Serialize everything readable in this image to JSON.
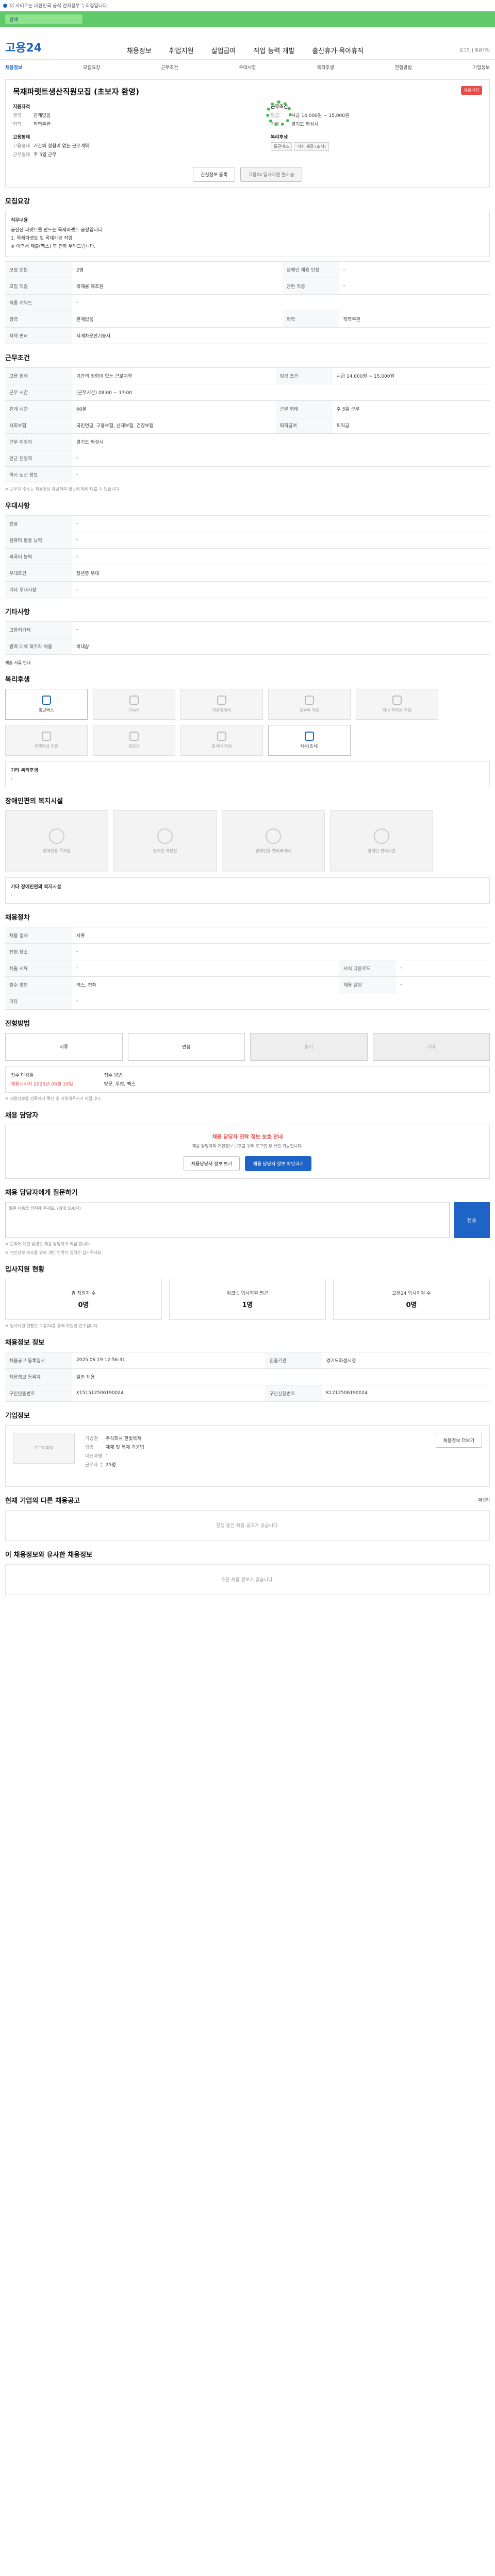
{
  "topbar": {
    "text": "이 사이트는 대한민국 공식 전자정부 누리집입니다."
  },
  "search": {
    "label": "검색"
  },
  "header": {
    "logo_prefix": "고용",
    "logo_suffix": "24",
    "gnb": [
      "채용정보",
      "취업지원",
      "실업급여",
      "직업 능력 개발",
      "출산휴가·육아휴직"
    ],
    "util": "로그인 | 회원가입"
  },
  "tabs": [
    "채용정보",
    "모집요강",
    "근무조건",
    "우대사항",
    "복리후생",
    "전형방법",
    "기업정보"
  ],
  "summary": {
    "title": "목재파렛트생산직원모집 (초보자 환영)",
    "badge": "채용마감",
    "group1": "지원자격",
    "rows1": [
      {
        "k": "경력",
        "v": "관계없음"
      },
      {
        "k": "학력",
        "v": "학력무관"
      }
    ],
    "group2": "고용형태",
    "rows2": [
      {
        "k": "고용형태",
        "v": "기간의 정함이 없는 근로계약"
      },
      {
        "k": "근무형태",
        "v": "주 5일 근무"
      }
    ],
    "group3": "근무조건",
    "rows3": [
      {
        "k": "임금",
        "v": "시급 14,000원 ~ 15,000원"
      },
      {
        "k": "지역",
        "v": "경기도 화성시"
      }
    ],
    "group4": "복리후생",
    "tags": [
      "통근버스",
      "식사 제공 (조식)"
    ],
    "btn_scrap": "관심정보 등록",
    "btn_apply": "고용24 입사지원 불가능"
  },
  "recruit": {
    "title": "모집요강",
    "job_title": "직무내용",
    "job_lines": [
      "공산산 파렛트를 만드는 목재파렛트 공장입니다.",
      "1. 목재파렛트 및 목재가공 작업",
      "※ 이력서 제출(팩스) 후 전화 부탁드립니다."
    ],
    "rows": [
      {
        "k": "모집 인원",
        "v": "2명",
        "k2": "장애인 채용 인정",
        "v2": "-"
      },
      {
        "k": "모집 직종",
        "v": "목재를 제조원",
        "k2": "관련 직종",
        "v2": "-"
      },
      {
        "k": "직종 키워드",
        "v": "-",
        "k2": "",
        "v2": ""
      },
      {
        "k": "경력",
        "v": "관계없음",
        "k2": "학력",
        "v2": "학력무관"
      },
      {
        "k": "자격 면허",
        "v": "지게차운전기능사",
        "k2": "",
        "v2": ""
      }
    ]
  },
  "conditions": {
    "title": "근무조건",
    "rows": [
      {
        "k": "고용 형태",
        "v": "기간의 정함이 없는 근로계약",
        "k2": "임금 조건",
        "v2": "시급 14,000원 ~ 15,000원"
      },
      {
        "k": "근무 시간",
        "v": "(근무시간) 08:00 ~ 17:00",
        "k2": "",
        "v2": ""
      },
      {
        "k": "휴게 시간",
        "v": "60분",
        "k2": "근무 형태",
        "v2": "주 5일 근무"
      },
      {
        "k": "사회보험",
        "v": "국민연금, 고용보험, 산재보험, 건강보험",
        "k2": "퇴직급여",
        "v2": "퇴직금"
      },
      {
        "k": "근무 예정지",
        "v": "경기도 화성시",
        "k2": "",
        "v2": ""
      },
      {
        "k": "인근 전철역",
        "v": "-",
        "k2": "",
        "v2": ""
      },
      {
        "k": "역시 노선 정보",
        "v": "-",
        "k2": "",
        "v2": ""
      }
    ],
    "map_btn": "지도 보기",
    "note": "※ 근무지 주소는 채용정보 제공처의 정보에 따라 다를 수 있습니다."
  },
  "prefs": {
    "title": "우대사항",
    "rows": [
      {
        "k": "전공",
        "v": "-"
      },
      {
        "k": "컴퓨터 활용 능력",
        "v": "-"
      },
      {
        "k": "외국어 능력",
        "v": "-"
      },
      {
        "k": "우대조건",
        "v": "장년층 우대"
      },
      {
        "k": "기타 우대사항",
        "v": "-"
      }
    ]
  },
  "etc": {
    "title": "기타사항",
    "rows": [
      {
        "k": "고용허가제",
        "v": "-"
      },
      {
        "k": "병역 대체 복무자 채용",
        "v": "비대상"
      }
    ],
    "link": "제출 서류 안내"
  },
  "welfare": {
    "title": "복리후생",
    "items": [
      {
        "label": "통근버스",
        "on": true
      },
      {
        "label": "기숙사",
        "on": false
      },
      {
        "label": "차량유지비",
        "on": false
      },
      {
        "label": "교육비 지원",
        "on": false
      },
      {
        "label": "자녀 학자금 지원",
        "on": false
      },
      {
        "label": "주택자금 지원",
        "on": false
      },
      {
        "label": "경조금",
        "on": false
      },
      {
        "label": "중식비 지원",
        "on": false
      },
      {
        "label": "식사(조식)",
        "on": true
      }
    ],
    "etc_label": "기타 복리후생",
    "etc_value": "-"
  },
  "disability": {
    "title": "장애인편의 복지시설",
    "items": [
      "장애인용 주차장",
      "장애인 화장실",
      "장애인용 엘리베이터",
      "장애인 편의시설"
    ],
    "etc_label": "기타 장애인편의 복지시설",
    "etc_value": "-"
  },
  "process": {
    "title": "채용절차",
    "rows": [
      {
        "k": "채용 절차",
        "v": "서류",
        "k2": "",
        "v2": ""
      },
      {
        "k": "전형 장소",
        "v": "-",
        "k2": "",
        "v2": ""
      },
      {
        "k": "제출 서류",
        "v": "-",
        "k2": "서식 다운로드",
        "v2": "-"
      },
      {
        "k": "접수 방법",
        "v": "팩스, 전화",
        "k2": "채용 담당",
        "v2": "-"
      },
      {
        "k": "기타",
        "v": "-",
        "k2": "",
        "v2": ""
      }
    ]
  },
  "ways": {
    "title": "전형방법",
    "items": [
      {
        "label": "서류",
        "on": true
      },
      {
        "label": "면접",
        "on": true
      },
      {
        "label": "필기",
        "on": false
      },
      {
        "label": "기타",
        "on": false
      }
    ],
    "deadline_label": "접수 마감일",
    "deadline": "채용시까지 2025년 06월 19일",
    "method_label": "접수 방법",
    "method": "방문, 우편, 팩스",
    "apply_note": "※ 채용정보를 정확하게 확인 후 지원해주시기 바랍니다."
  },
  "contact": {
    "title": "채용 담당자",
    "alert": "채용 담당자 연락 정보 보호 안내",
    "desc": "채용 담당자의 개인정보 보호를 위해 로그인 후 확인 가능합니다.",
    "btn1": "채용담당자 정보 보기",
    "btn2": "채용 담당자 정보 확인하기"
  },
  "qa": {
    "title": "채용 담당자에게 질문하기",
    "placeholder": "질문 내용을 입력해 주세요. (최대 500자)",
    "send": "전송",
    "notes": [
      "※ 문의에 대한 답변은 채용 담당자가 직접 합니다.",
      "※ 개인정보 보호를 위해 개인 연락처 입력은 삼가주세요."
    ]
  },
  "stats": {
    "title": "입사지원 현황",
    "items": [
      {
        "label": "총 지원자 수",
        "value": "0명"
      },
      {
        "label": "워크넷 입사지원 평균",
        "value": "1명"
      },
      {
        "label": "고용24 입사지원 수",
        "value": "0명"
      }
    ],
    "note": "※ 입사지원 현황은 고용24를 통해 지원한 건수입니다."
  },
  "info": {
    "title": "채용정보 정보",
    "rows": [
      {
        "k": "채용공고 등록일시",
        "v": "2025.06.19 12:56:31",
        "k2": "인증기관",
        "v2": "경기도화성시청"
      },
      {
        "k": "채용정보 등록자",
        "v": "일반 채용",
        "k2": "",
        "v2": ""
      },
      {
        "k": "구인인증번호",
        "v": "K151512506190024",
        "k2": "구인신청번호",
        "v2": "K1212506190024"
      }
    ]
  },
  "company": {
    "title": "기업정보",
    "logo": "로고이미지",
    "rows": [
      {
        "k": "기업명",
        "v": "주식회사 한빛목재"
      },
      {
        "k": "업종",
        "v": "제재 및 목재 가공업"
      },
      {
        "k": "대표자명",
        "v": "-"
      },
      {
        "k": "근로자 수",
        "v": "25명"
      }
    ],
    "btn": "채용정보 더보기"
  },
  "same": {
    "title": "현재 기업의 다른 채용공고",
    "more": "더보기",
    "empty": "진행 중인 채용 공고가 없습니다."
  },
  "recommend": {
    "title": "이 채용정보와 유사한 채용정보",
    "empty": "추천 채용 정보가 없습니다."
  }
}
